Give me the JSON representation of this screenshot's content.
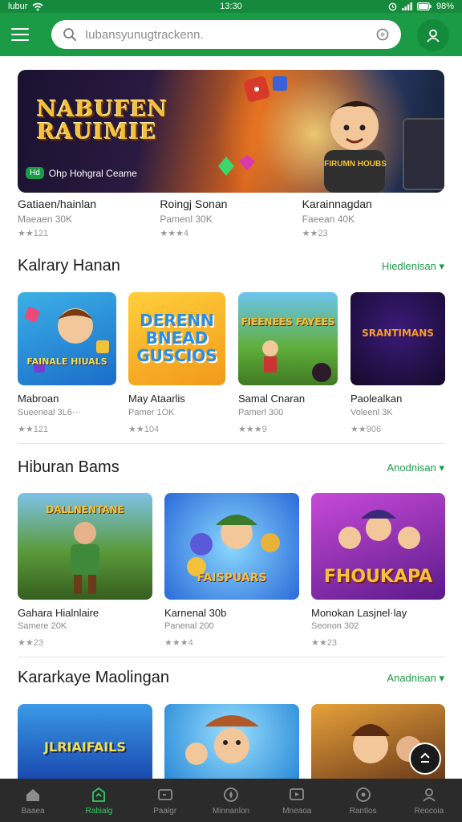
{
  "status_bar": {
    "carrier": "lubur",
    "time": "13:30",
    "battery": "98%"
  },
  "search": {
    "placeholder": "Iubansyunugtrackenn."
  },
  "banner": {
    "logo_line1": "NABUFEN",
    "logo_line2": "RAUIMIE",
    "badge": "Hd",
    "caption": "Ohp Hohgral Ceame",
    "hero_shirt": "FIRUMN HOUBS"
  },
  "banner_items": [
    {
      "title": "Gatiaen/hainlan",
      "sub": "Maeaen 30K",
      "rating": "★★121"
    },
    {
      "title": "Roingj Sonan",
      "sub": "Pamenl 30K",
      "rating": "★★★4"
    },
    {
      "title": "Karainnagdan",
      "sub": "Faeean 40K",
      "rating": "★★23"
    }
  ],
  "sections": [
    {
      "title": "Kalrary Hanan",
      "more": "Hiedlenisan ▾",
      "items": [
        {
          "title": "Mabroan",
          "sub": "Sueeneal 3L6···",
          "rating": "★★121",
          "art": "FAINALE HIUALS"
        },
        {
          "title": "May Ataarlis",
          "sub": "Pamer 1OK",
          "rating": "★★104",
          "art": "DERENN BNEAD GUSCIOS"
        },
        {
          "title": "Samal Cnaran",
          "sub": "Pamerl 300",
          "rating": "★★★9",
          "art": "FIEENEES FAYEES"
        },
        {
          "title": "Paolealkan",
          "sub": "Voleenl 3K",
          "rating": "★★906",
          "art": "SRANTIMANS"
        }
      ]
    },
    {
      "title": "Hiburan Bams",
      "more": "Anodnisan ▾",
      "items": [
        {
          "title": "Gahara Hialnlaire",
          "sub": "Samere 20K",
          "rating": "★★23",
          "art": "DALLNENTANE"
        },
        {
          "title": "Karnenal 30b",
          "sub": "Panenal 200",
          "rating": "★★★4",
          "art": "FAISPUARS"
        },
        {
          "title": "Monokan Lasjnel·lay",
          "sub": "Seonon 302",
          "rating": "★★23",
          "art": "FHOUKAPA"
        }
      ]
    },
    {
      "title": "Kararkaye Maolingan",
      "more": "Anadnisan ▾",
      "items": [
        {
          "art": "JLRIAIFAILS"
        },
        {
          "art": ""
        },
        {
          "art": ""
        }
      ]
    }
  ],
  "bottom_nav": [
    {
      "label": "Baaea",
      "icon": "home-icon"
    },
    {
      "label": "Rabialg",
      "icon": "store-icon"
    },
    {
      "label": "Paalgr",
      "icon": "games-icon"
    },
    {
      "label": "Minnanlon",
      "icon": "compass-icon"
    },
    {
      "label": "Mneaoa",
      "icon": "media-icon"
    },
    {
      "label": "Rantlos",
      "icon": "circle-icon"
    },
    {
      "label": "Reocoia",
      "icon": "profile-icon"
    }
  ],
  "colors": {
    "brand_green": "#1c9b47",
    "nav_active": "#2ecc62",
    "nav_bg": "#2b2b2b"
  }
}
